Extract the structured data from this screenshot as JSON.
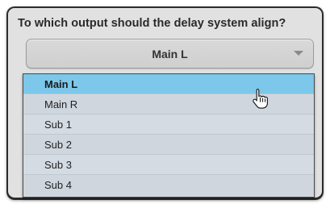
{
  "dialog": {
    "question": "To which output should the delay system align?"
  },
  "select": {
    "value": "Main L"
  },
  "menu": {
    "items": [
      {
        "label": "Main L",
        "selected": true
      },
      {
        "label": "Main R",
        "selected": false
      },
      {
        "label": "Sub 1",
        "selected": false
      },
      {
        "label": "Sub 2",
        "selected": false
      },
      {
        "label": "Sub 3",
        "selected": false
      },
      {
        "label": "Sub 4",
        "selected": false
      }
    ]
  },
  "icons": {
    "chevron": "chevron-down-icon",
    "cursor": "hand-pointer-icon"
  },
  "colors": {
    "selected_item": "#7cc7ea",
    "menu_background": "#d0d7df",
    "dialog_background": "#e1e1e1",
    "frame": "#2a2a2a"
  }
}
